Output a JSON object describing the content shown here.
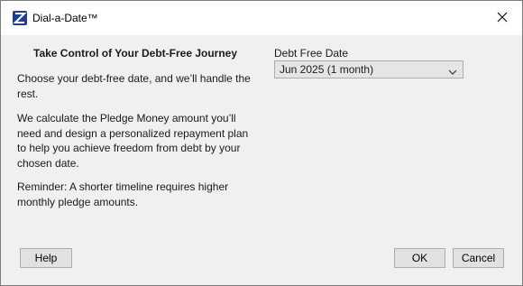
{
  "window": {
    "title": "Dial-a-Date™"
  },
  "left": {
    "heading": "Take Control of Your Debt-Free Journey",
    "paragraph1": "Choose your debt-free date, and we’ll handle the rest.",
    "paragraph2": "We calculate the Pledge Money amount you’ll need and design a personalized repayment plan to help you achieve freedom from debt by your chosen date.",
    "paragraph3": "Reminder: A shorter timeline requires higher monthly pledge amounts."
  },
  "right": {
    "field_label": "Debt Free Date",
    "selected_value": "Jun 2025 (1 month)"
  },
  "buttons": {
    "help": "Help",
    "ok": "OK",
    "cancel": "Cancel"
  },
  "colors": {
    "brand_icon": "#1f3f8f",
    "window_bg": "#f0f0f0",
    "titlebar_bg": "#ffffff"
  }
}
